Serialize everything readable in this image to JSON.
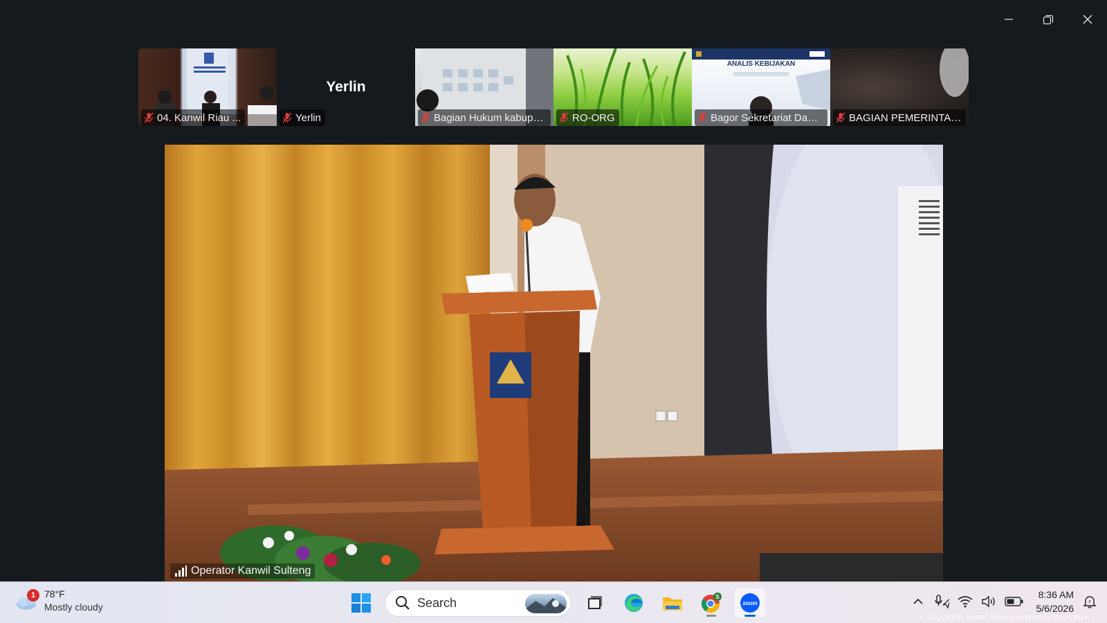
{
  "window": {
    "controls": [
      "minimize-icon",
      "restore-icon",
      "close-icon"
    ]
  },
  "participants": [
    {
      "name": "04. Kanwil Riau ...",
      "muted": true,
      "video": "room"
    },
    {
      "name": "Yerlin",
      "display_name": "Yerlin",
      "muted": true,
      "video": "off"
    },
    {
      "name": "Bagian Hukum kabupa...",
      "muted": true,
      "video": "wall"
    },
    {
      "name": "RO-ORG",
      "muted": true,
      "video": "grass"
    },
    {
      "name": "Bagor Sekretariat Daer...",
      "muted": true,
      "video": "poster",
      "poster_title": "ANALIS KEBIJAKAN"
    },
    {
      "name": "BAGIAN PEMERINTAH...",
      "muted": true,
      "video": "blurred"
    }
  ],
  "main_video": {
    "speaker": "Operator Kanwil Sulteng",
    "watermark": "© Copyright | Kanwil Wilayah Kementerian Hukum"
  },
  "taskbar": {
    "weather": {
      "badge": "1",
      "temp": "78°F",
      "condition": "Mostly cloudy"
    },
    "search_label": "Search",
    "apps": [
      "task-view-icon",
      "edge-icon",
      "file-explorer-icon",
      "chrome-icon",
      "zoom-icon"
    ],
    "clock": {
      "time": "8:36 AM",
      "date": "5/6/2026"
    }
  },
  "colors": {
    "window_bg": "#151a1f",
    "mute_red": "#e03c3c",
    "accent": "#0067c0",
    "zoom_blue": "#0b5cff"
  }
}
